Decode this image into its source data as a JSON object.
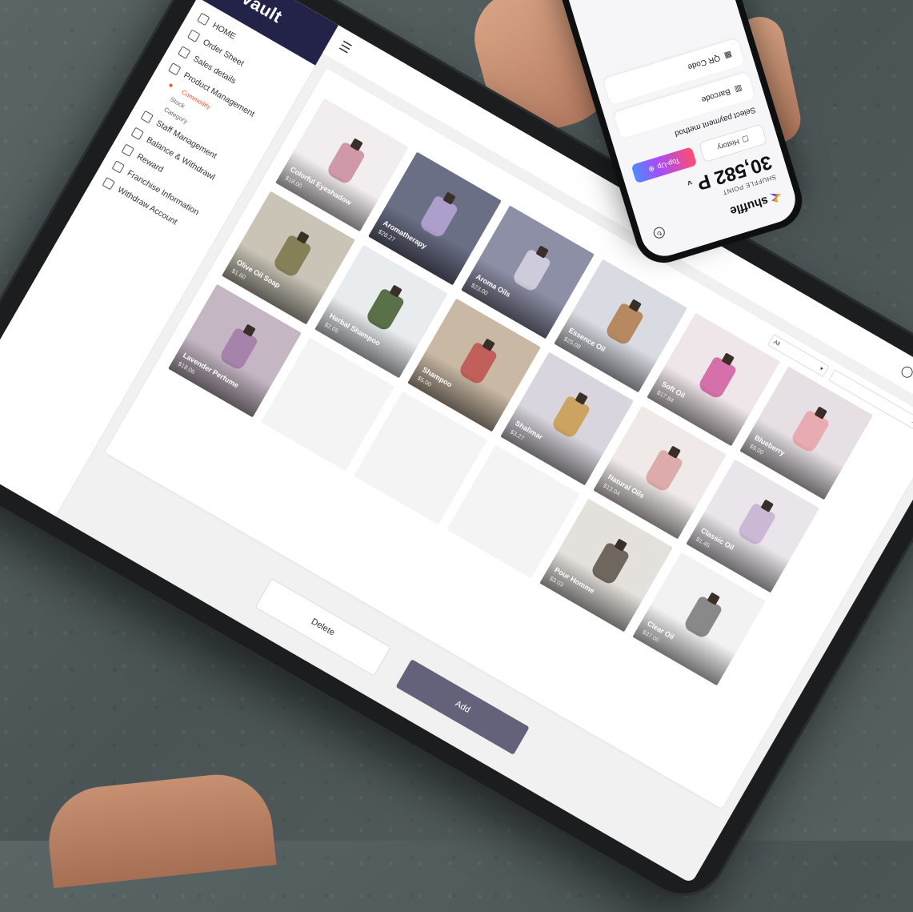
{
  "sidebar": {
    "brand": "Vault",
    "nav": [
      {
        "label": "HOME",
        "type": "item"
      },
      {
        "label": "Order Sheet",
        "type": "item"
      },
      {
        "label": "Sales details",
        "type": "item"
      },
      {
        "label": "Product Management",
        "type": "item"
      },
      {
        "label": "Commodity",
        "type": "sub-active"
      },
      {
        "label": "Stock",
        "type": "sub"
      },
      {
        "label": "Category",
        "type": "sub"
      },
      {
        "label": "Staff Management",
        "type": "item"
      },
      {
        "label": "Balance & Withdrawl",
        "type": "item"
      },
      {
        "label": "Reward",
        "type": "item"
      },
      {
        "label": "Franchise Information",
        "type": "item"
      },
      {
        "label": "Withdraw Account",
        "type": "item"
      }
    ]
  },
  "toolbar": {
    "filter_value": "All"
  },
  "products": [
    {
      "name": "Colorful Eyeshadow",
      "price": "$18.00",
      "bg": "#f2eef0",
      "accent": "#c98a9a"
    },
    {
      "name": "Aromatherapy",
      "price": "$28.27",
      "bg": "#6b6f86",
      "accent": "#b9a8d8"
    },
    {
      "name": "Aroma Oils",
      "price": "$23.00",
      "bg": "#8d8fa6",
      "accent": "#d9d6e6"
    },
    {
      "name": "Essence Oil",
      "price": "$25.08",
      "bg": "#d9dbe3",
      "accent": "#b07a4a"
    },
    {
      "name": "Soft Oil",
      "price": "$17.84",
      "bg": "#efe6ea",
      "accent": "#d05aa0"
    },
    {
      "name": "Blueberry",
      "price": "$9.00",
      "bg": "#e6e0e4",
      "accent": "#e7a1a8"
    },
    {
      "name": "Olive Oil Soap",
      "price": "$1.60",
      "bg": "#c9c4b6",
      "accent": "#7a7448"
    },
    {
      "name": "Herbal Shampoo",
      "price": "$2.05",
      "bg": "#e9ecef",
      "accent": "#3f5a2c"
    },
    {
      "name": "Shampoo",
      "price": "$5.00",
      "bg": "#c9b8a4",
      "accent": "#c0504e"
    },
    {
      "name": "Shalimar",
      "price": "$3.27",
      "bg": "#d9d5de",
      "accent": "#c99a4a"
    },
    {
      "name": "Natural Oils",
      "price": "$13.04",
      "bg": "#efeae7",
      "accent": "#d9a0a0"
    },
    {
      "name": "Classic Oil",
      "price": "$1.45",
      "bg": "#e9e5ea",
      "accent": "#c6b0d0"
    },
    {
      "name": "Lavender Perfume",
      "price": "$18.06",
      "bg": "#c5b6c4",
      "accent": "#a07aa6"
    },
    {
      "name": "",
      "price": "",
      "bg": "#f4f4f5",
      "accent": "#ffffff"
    },
    {
      "name": "",
      "price": "",
      "bg": "#f4f4f5",
      "accent": "#ffffff"
    },
    {
      "name": "",
      "price": "",
      "bg": "#f4f4f5",
      "accent": "#ffffff"
    },
    {
      "name": "Pour Homme",
      "price": "$3.03",
      "bg": "#e4e1dc",
      "accent": "#5a5048"
    },
    {
      "name": "Clear Oil",
      "price": "$37.00",
      "bg": "#f2f2f3",
      "accent": "#777777"
    }
  ],
  "actions": {
    "delete_label": "Delete",
    "add_label": "Add"
  },
  "phone": {
    "brand": "shuffle",
    "points_label": "SHUFFLE POINT",
    "points_value": "30,582 P",
    "topup_label": "Top-Up",
    "history_label": "History",
    "method_label": "Select payment method",
    "barcode_label": "Barcode",
    "qr_label": "QR Code"
  },
  "colors": {
    "brand_navy": "#23234a",
    "add_button": "#63627a",
    "active_orange": "#e45b2a",
    "online_green": "#2fbf71"
  }
}
